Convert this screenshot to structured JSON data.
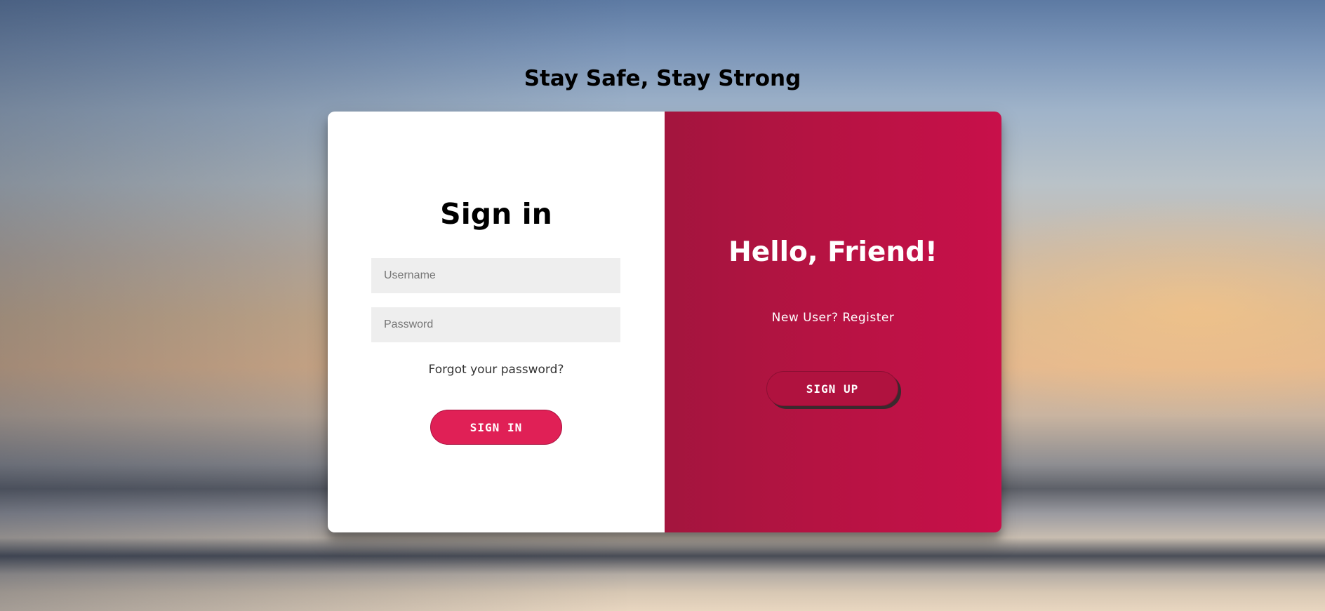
{
  "page": {
    "title": "Stay Safe, Stay Strong"
  },
  "signin": {
    "heading": "Sign in",
    "username_placeholder": "Username",
    "password_placeholder": "Password",
    "forgot_password": "Forgot your password?",
    "button_label": "SIGN IN"
  },
  "signup": {
    "heading": "Hello, Friend!",
    "register_text": "New User? Register",
    "button_label": "SIGN UP"
  },
  "colors": {
    "accent": "#e02056",
    "panel_gradient_start": "#a3153e",
    "panel_gradient_end": "#c8104a"
  }
}
